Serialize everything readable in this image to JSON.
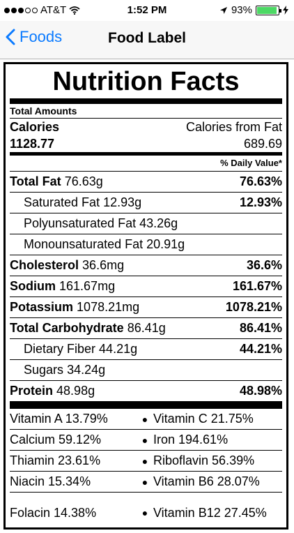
{
  "status_bar": {
    "carrier": "AT&T",
    "time": "1:52 PM",
    "battery": "93%",
    "battery_level": 0.93,
    "signal_icon": "signal-dots-icon",
    "wifi_icon": "wifi-icon",
    "location_icon": "location-arrow-icon",
    "charging_icon": "charging-bolt-icon"
  },
  "nav": {
    "back_label": "Foods",
    "title": "Food Label",
    "accent_color": "#0a7aff"
  },
  "label": {
    "title": "Nutrition Facts",
    "total_amounts": "Total Amounts",
    "calories_label": "Calories",
    "calories_from_fat_label": "Calories from Fat",
    "calories_value": "1128.77",
    "calories_from_fat_value": "689.69",
    "daily_value_header": "% Daily Value*",
    "nutrients": [
      {
        "name": "Total Fat",
        "amount": "76.63g",
        "percent": "76.63%",
        "bold": true,
        "indent": false
      },
      {
        "name": "Saturated Fat",
        "amount": "12.93g",
        "percent": "12.93%",
        "bold": false,
        "indent": true
      },
      {
        "name": "Polyunsaturated Fat",
        "amount": "43.26g",
        "percent": "",
        "bold": false,
        "indent": true
      },
      {
        "name": "Monounsaturated Fat",
        "amount": "20.91g",
        "percent": "",
        "bold": false,
        "indent": true
      },
      {
        "name": "Cholesterol",
        "amount": "36.6mg",
        "percent": "36.6%",
        "bold": true,
        "indent": false
      },
      {
        "name": "Sodium",
        "amount": "161.67mg",
        "percent": "161.67%",
        "bold": true,
        "indent": false
      },
      {
        "name": "Potassium",
        "amount": "1078.21mg",
        "percent": "1078.21%",
        "bold": true,
        "indent": false
      },
      {
        "name": "Total Carbohydrate",
        "amount": "86.41g",
        "percent": "86.41%",
        "bold": true,
        "indent": false
      },
      {
        "name": "Dietary Fiber",
        "amount": "44.21g",
        "percent": "44.21%",
        "bold": false,
        "indent": true
      },
      {
        "name": "Sugars",
        "amount": "34.24g",
        "percent": "",
        "bold": false,
        "indent": true
      },
      {
        "name": "Protein",
        "amount": "48.98g",
        "percent": "48.98%",
        "bold": true,
        "indent": false
      }
    ],
    "vitamins": [
      {
        "left": "Vitamin A 13.79%",
        "right": "Vitamin C 21.75%"
      },
      {
        "left": "Calcium 59.12%",
        "right": "Iron 194.61%"
      },
      {
        "left": "Thiamin 23.61%",
        "right": "Riboflavin 56.39%"
      },
      {
        "left": "Niacin 15.34%",
        "right": "Vitamin B6 28.07%"
      },
      {
        "left": "Folacin 14.38%",
        "right": "Vitamin B12 27.45%"
      }
    ]
  }
}
